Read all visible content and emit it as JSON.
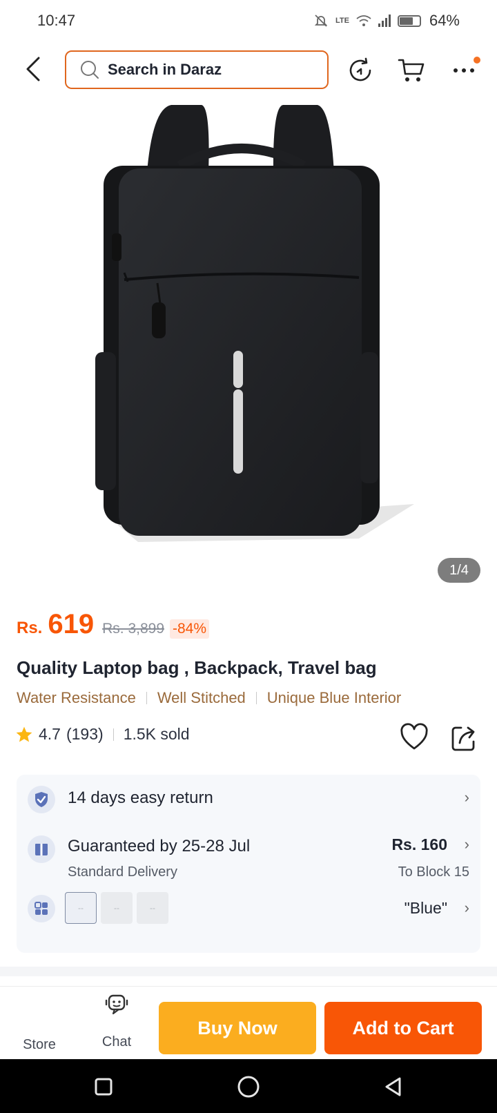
{
  "status_bar": {
    "time": "10:47",
    "network_label": "LTE",
    "battery_pct": "64%"
  },
  "header": {
    "search_placeholder": "Search in Daraz",
    "icons": [
      "back-arrow-icon",
      "search-icon",
      "history-icon",
      "cart-icon",
      "more-icon"
    ]
  },
  "gallery": {
    "counter": "1/4"
  },
  "product": {
    "currency": "Rs.",
    "price": "619",
    "original_price": "Rs. 3,899",
    "discount": "-84%",
    "title": "Quality Laptop bag , Backpack, Travel bag",
    "features": [
      "Water Resistance",
      "Well Stitched",
      "Unique Blue Interior"
    ],
    "rating": "4.7",
    "rating_count": "(193)",
    "sold": "1.5K sold"
  },
  "info": {
    "returns": "14 days easy return",
    "delivery_title": "Guaranteed by 25-28 Jul",
    "delivery_sub": "Standard Delivery",
    "shipping_price": "Rs. 160",
    "shipping_to": "To Block 15",
    "variant_value": "\"Blue\""
  },
  "bottom_bar": {
    "store": "Store",
    "chat": "Chat",
    "buy_now": "Buy Now",
    "add_to_cart": "Add to Cart"
  },
  "colors": {
    "accent": "#f85606",
    "buy_now": "#fbad1f",
    "feature_text": "#9a6a3b"
  }
}
